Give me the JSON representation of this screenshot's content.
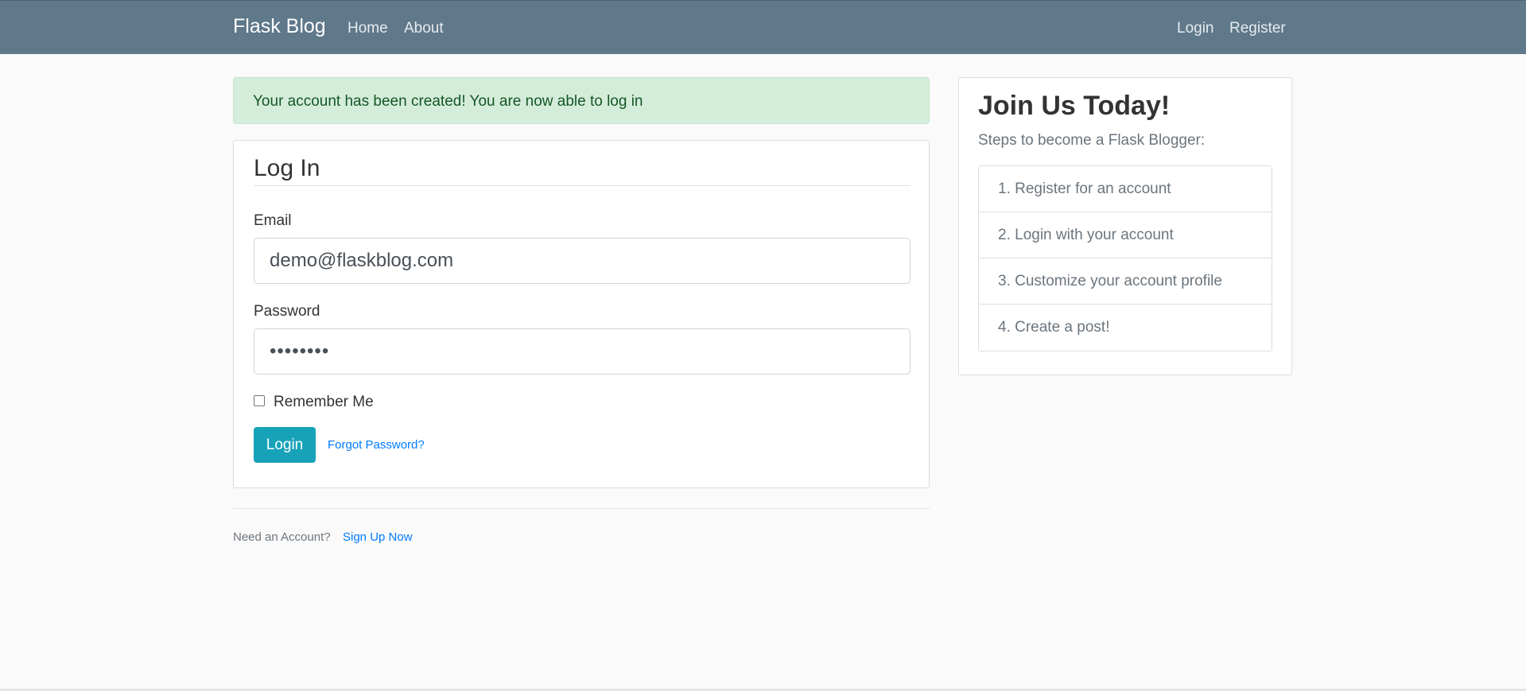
{
  "navbar": {
    "brand": "Flask Blog",
    "left_links": [
      "Home",
      "About"
    ],
    "right_links": [
      "Login",
      "Register"
    ],
    "color": "#5f788a"
  },
  "alert": {
    "message": "Your account has been created! You are now able to log in",
    "type": "success"
  },
  "login_form": {
    "legend": "Log In",
    "email_label": "Email",
    "email_value": "demo@flaskblog.com",
    "password_label": "Password",
    "password_value": "••••••••",
    "remember_label": "Remember Me",
    "remember_checked": false,
    "submit_label": "Login",
    "forgot_label": "Forgot Password?"
  },
  "footer": {
    "prompt": "Need an Account?",
    "signup_label": "Sign Up Now"
  },
  "sidebar": {
    "title": "Join Us Today!",
    "subtitle": "Steps to become a Flask Blogger:",
    "steps": [
      "1. Register for an account",
      "2. Login with your account",
      "3. Customize your account profile",
      "4. Create a post!"
    ]
  }
}
